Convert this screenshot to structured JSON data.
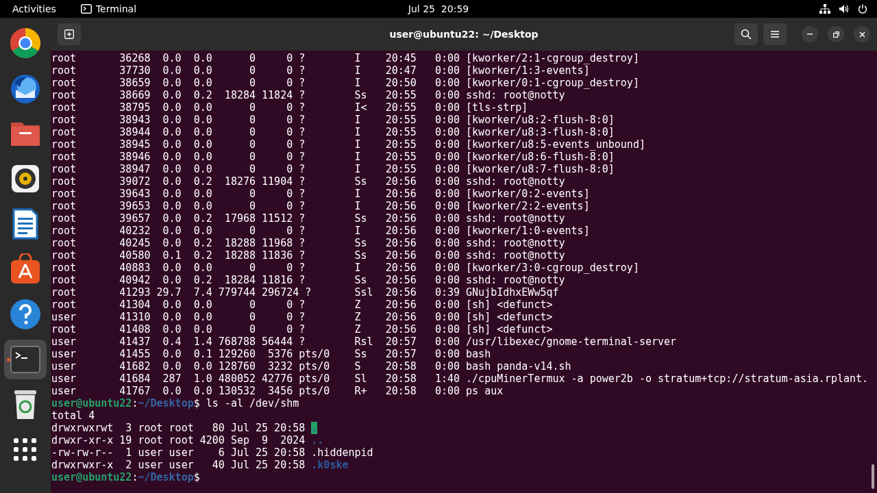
{
  "top_bar": {
    "activities": "Activities",
    "app_name": "Terminal",
    "clock": "Jul 25  20:59"
  },
  "dock": [
    {
      "kind": "chrome",
      "selected": false
    },
    {
      "kind": "mail",
      "selected": false
    },
    {
      "kind": "files",
      "selected": false
    },
    {
      "kind": "music",
      "selected": false
    },
    {
      "kind": "writer",
      "selected": false
    },
    {
      "kind": "store",
      "selected": false
    },
    {
      "kind": "help",
      "selected": false
    },
    {
      "kind": "terminal",
      "selected": true
    },
    {
      "kind": "trash",
      "selected": false
    },
    {
      "kind": "grid",
      "selected": false
    }
  ],
  "window": {
    "title": "user@ubuntu22: ~/Desktop"
  },
  "terminal": [
    {
      "kind": "plain",
      "text": "root       36268  0.0  0.0      0     0 ?        I    20:45   0:00 [kworker/2:1-cgroup_destroy]"
    },
    {
      "kind": "plain",
      "text": "root       37730  0.0  0.0      0     0 ?        I    20:47   0:00 [kworker/1:3-events]"
    },
    {
      "kind": "plain",
      "text": "root       38659  0.0  0.0      0     0 ?        I    20:50   0:00 [kworker/0:1-cgroup_destroy]"
    },
    {
      "kind": "plain",
      "text": "root       38669  0.0  0.2  18284 11824 ?        Ss   20:55   0:00 sshd: root@notty"
    },
    {
      "kind": "plain",
      "text": "root       38795  0.0  0.0      0     0 ?        I<   20:55   0:00 [tls-strp]"
    },
    {
      "kind": "plain",
      "text": "root       38943  0.0  0.0      0     0 ?        I    20:55   0:00 [kworker/u8:2-flush-8:0]"
    },
    {
      "kind": "plain",
      "text": "root       38944  0.0  0.0      0     0 ?        I    20:55   0:00 [kworker/u8:3-flush-8:0]"
    },
    {
      "kind": "plain",
      "text": "root       38945  0.0  0.0      0     0 ?        I    20:55   0:00 [kworker/u8:5-events_unbound]"
    },
    {
      "kind": "plain",
      "text": "root       38946  0.0  0.0      0     0 ?        I    20:55   0:00 [kworker/u8:6-flush-8:0]"
    },
    {
      "kind": "plain",
      "text": "root       38947  0.0  0.0      0     0 ?        I    20:55   0:00 [kworker/u8:7-flush-8:0]"
    },
    {
      "kind": "plain",
      "text": "root       39072  0.0  0.2  18276 11904 ?        Ss   20:56   0:00 sshd: root@notty"
    },
    {
      "kind": "plain",
      "text": "root       39643  0.0  0.0      0     0 ?        I    20:56   0:00 [kworker/0:2-events]"
    },
    {
      "kind": "plain",
      "text": "root       39653  0.0  0.0      0     0 ?        I    20:56   0:00 [kworker/2:2-events]"
    },
    {
      "kind": "plain",
      "text": "root       39657  0.0  0.2  17968 11512 ?        Ss   20:56   0:00 sshd: root@notty"
    },
    {
      "kind": "plain",
      "text": "root       40232  0.0  0.0      0     0 ?        I    20:56   0:00 [kworker/1:0-events]"
    },
    {
      "kind": "plain",
      "text": "root       40245  0.0  0.2  18288 11968 ?        Ss   20:56   0:00 sshd: root@notty"
    },
    {
      "kind": "plain",
      "text": "root       40580  0.1  0.2  18288 11836 ?        Ss   20:56   0:00 sshd: root@notty"
    },
    {
      "kind": "plain",
      "text": "root       40883  0.0  0.0      0     0 ?        I    20:56   0:00 [kworker/3:0-cgroup_destroy]"
    },
    {
      "kind": "plain",
      "text": "root       40942  0.0  0.2  18284 11816 ?        Ss   20:56   0:00 sshd: root@notty"
    },
    {
      "kind": "plain",
      "text": "root       41293 29.7  7.4 779744 296724 ?       Ssl  20:56   0:39 GNujbIdhxEWw5qf"
    },
    {
      "kind": "plain",
      "text": "root       41304  0.0  0.0      0     0 ?        Z    20:56   0:00 [sh] <defunct>"
    },
    {
      "kind": "plain",
      "text": "user       41310  0.0  0.0      0     0 ?        Z    20:56   0:00 [sh] <defunct>"
    },
    {
      "kind": "plain",
      "text": "root       41408  0.0  0.0      0     0 ?        Z    20:56   0:00 [sh] <defunct>"
    },
    {
      "kind": "plain",
      "text": "user       41437  0.4  1.4 768788 56444 ?        Rsl  20:57   0:00 /usr/libexec/gnome-terminal-server"
    },
    {
      "kind": "plain",
      "text": "user       41455  0.0  0.1 129260  5376 pts/0    Ss   20:57   0:00 bash"
    },
    {
      "kind": "plain",
      "text": "user       41682  0.0  0.0 128760  3232 pts/0    S    20:58   0:00 bash panda-v14.sh"
    },
    {
      "kind": "plain",
      "text": "user       41684  287  1.0 480052 42776 pts/0    Sl   20:58   1:40 ./cpuMinerTermux -a power2b -o stratum+tcp://stratum-asia.rplant."
    },
    {
      "kind": "plain",
      "text": "user       41767  0.0  0.0 130532  3456 pts/0    R+   20:58   0:00 ps aux"
    },
    {
      "kind": "prompt",
      "user": "user@ubuntu22",
      "separator": ":",
      "path": "~/Desktop",
      "command": "$ ls -al /dev/shm"
    },
    {
      "kind": "plain",
      "text": "total 4"
    },
    {
      "kind": "listing",
      "text": "drwxrwxrwt  3 root root   80 Jul 25 20:58 ",
      "entry": {
        "name": ".",
        "kind": "sticky-dir"
      }
    },
    {
      "kind": "listing",
      "text": "drwxr-xr-x 19 root root 4200 Sep  9  2024 ",
      "entry": {
        "name": "..",
        "kind": "dir"
      }
    },
    {
      "kind": "listing",
      "text": "-rw-rw-r--  1 user user    6 Jul 25 20:58 ",
      "entry": {
        "name": ".hiddenpid",
        "kind": "file"
      }
    },
    {
      "kind": "listing",
      "text": "drwxrwxr-x  2 user user   40 Jul 25 20:58 ",
      "entry": {
        "name": ".k0ske",
        "kind": "dir"
      }
    },
    {
      "kind": "prompt",
      "user": "user@ubuntu22",
      "separator": ":",
      "path": "~/Desktop",
      "command": "$"
    }
  ]
}
